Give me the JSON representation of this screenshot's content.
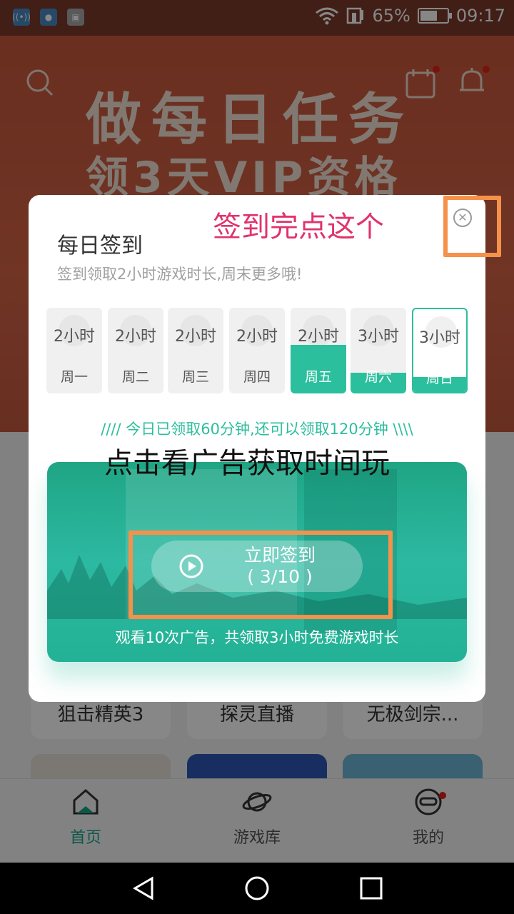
{
  "status_bar": {
    "battery_percent": "65%",
    "battery_level": 0.65,
    "time": "09:17"
  },
  "banner": {
    "line1": "做每日任务",
    "line2": "领3天VIP资格"
  },
  "dialog": {
    "title": "每日签到",
    "subtitle": "签到领取2小时游戏时长,周末更多哦!",
    "days": [
      {
        "hours": "2小时",
        "name": "周一",
        "fill": 0
      },
      {
        "hours": "2小时",
        "name": "周二",
        "fill": 0
      },
      {
        "hours": "2小时",
        "name": "周三",
        "fill": 0
      },
      {
        "hours": "2小时",
        "name": "周四",
        "fill": 0
      },
      {
        "hours": "2小时",
        "name": "周五",
        "fill": 0.57
      },
      {
        "hours": "3小时",
        "name": "周六",
        "fill": 0.24
      },
      {
        "hours": "3小时",
        "name": "周日",
        "fill": 0.18
      }
    ],
    "progress_text": "//// 今日已领取60分钟,还可以领取120分钟 \\\\\\\\",
    "checkin_button": {
      "line1": "立即签到",
      "line2": "( 3/10 )"
    },
    "ad_caption": "观看10次广告，共领取3小时免费游戏时长",
    "accent_color": "#2cbf9d"
  },
  "annotations": {
    "close_hint": "签到完点这个",
    "ad_hint": "点击看广告获取时间玩",
    "highlight_color": "#f5914a"
  },
  "games": [
    "狙击精英3",
    "探灵直播",
    "无极剑宗..."
  ],
  "bottom_nav": [
    {
      "label": "首页",
      "active": true
    },
    {
      "label": "游戏库",
      "active": false
    },
    {
      "label": "我的",
      "active": false
    }
  ]
}
